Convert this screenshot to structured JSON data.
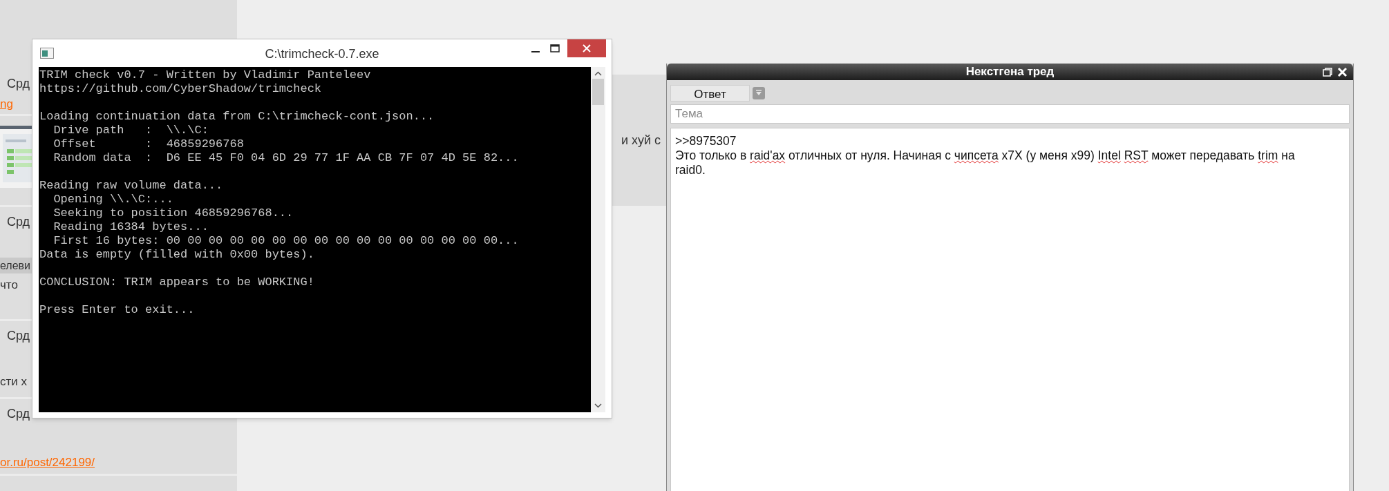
{
  "background_posts": [
    {
      "kind": "a",
      "items": [
        {
          "kind": "date",
          "text": "Срд"
        },
        {
          "kind": "link",
          "text": "ng"
        }
      ]
    },
    {
      "kind": "b"
    },
    {
      "kind": "c",
      "items": [
        {
          "kind": "date",
          "text": "Срд"
        },
        {
          "kind": "heading",
          "text": "елеви"
        },
        {
          "kind": "text",
          "text": "что"
        }
      ]
    },
    {
      "kind": "d",
      "items": [
        {
          "kind": "date",
          "text": "Срд"
        },
        {
          "kind": "text",
          "text": "сти х"
        }
      ]
    },
    {
      "kind": "e",
      "items": [
        {
          "kind": "date",
          "text": "Срд"
        },
        {
          "kind": "link",
          "text": "or.ru/post/242199/"
        }
      ]
    }
  ],
  "middle_post": {
    "text": "и хуй с"
  },
  "console_window": {
    "title": "C:\\trimcheck-0.7.exe",
    "blocks": [
      [
        "TRIM check v0.7 - Written by Vladimir Panteleev",
        "https://github.com/CyberShadow/trimcheck"
      ],
      [
        "Loading continuation data from C:\\trimcheck-cont.json...",
        "  Drive path   :  \\\\.\\C:",
        "  Offset       :  46859296768",
        "  Random data  :  D6 EE 45 F0 04 6D 29 77 1F AA CB 7F 07 4D 5E 82..."
      ],
      [
        "Reading raw volume data...",
        "  Opening \\\\.\\C:...",
        "  Seeking to position 46859296768...",
        "  Reading 16384 bytes...",
        "  First 16 bytes: 00 00 00 00 00 00 00 00 00 00 00 00 00 00 00 00...",
        "Data is empty (filled with 0x00 bytes)."
      ],
      [
        "CONCLUSION: TRIM appears to be WORKING!"
      ],
      [
        "Press Enter to exit..."
      ]
    ]
  },
  "reply_dialog": {
    "title": "Некстгена тред",
    "reply_button": "Ответ",
    "subject_placeholder": "Тема",
    "message_lines": [
      [
        {
          "text": ">>8975307",
          "misspelled": false
        }
      ],
      [
        {
          "text": "Это только в",
          "misspelled": false
        },
        {
          "text": "raid'ax",
          "misspelled": true
        },
        {
          "text": "отличных от нуля. Начиная с",
          "misspelled": false
        },
        {
          "text": "чипсета",
          "misspelled": true
        },
        {
          "text": "x7X (у меня x99)",
          "misspelled": false
        },
        {
          "text": "Intel",
          "misspelled": true
        },
        {
          "text": "RST",
          "misspelled": true
        },
        {
          "text": "может передавать",
          "misspelled": false
        },
        {
          "text": "trim",
          "misspelled": true
        },
        {
          "text": "на",
          "misspelled": false
        }
      ],
      [
        {
          "text": "raid0.",
          "misspelled": false
        }
      ]
    ]
  }
}
